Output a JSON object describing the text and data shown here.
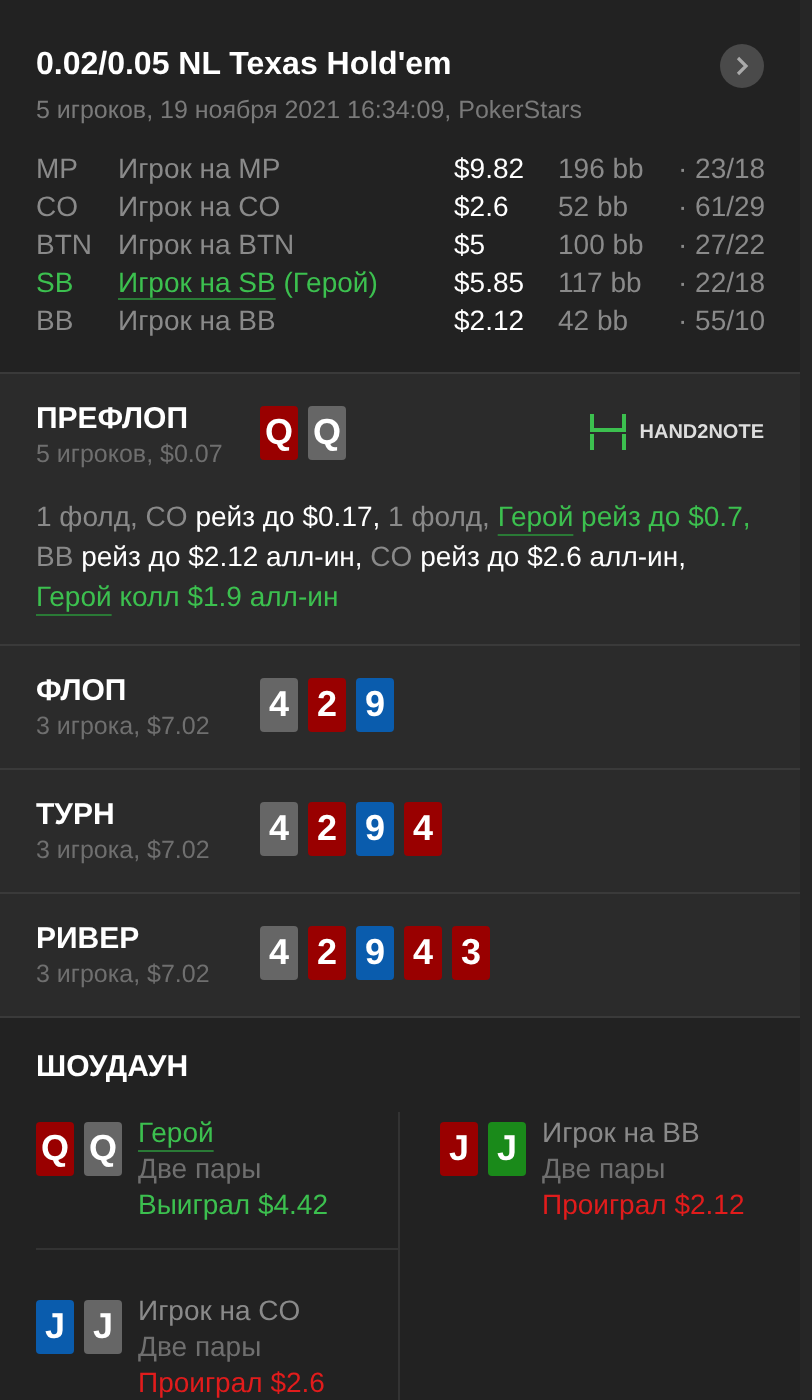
{
  "header": {
    "title": "0.02/0.05 NL Texas Hold'em",
    "subtitle": "5 игроков, 19 ноября 2021 16:34:09, PokerStars",
    "next_button": true
  },
  "players": [
    {
      "position": "MP",
      "name": "Игрок на MP",
      "hero": false,
      "stack": "$9.82",
      "bb": "196 bb",
      "stats": "· 23/18"
    },
    {
      "position": "CO",
      "name": "Игрок на CO",
      "hero": false,
      "stack": "$2.6",
      "bb": "52 bb",
      "stats": "· 61/29"
    },
    {
      "position": "BTN",
      "name": "Игрок на BTN",
      "hero": false,
      "stack": "$5",
      "bb": "100 bb",
      "stats": "· 27/22"
    },
    {
      "position": "SB",
      "name": "Игрок на SB",
      "hero_tag": "(Герой)",
      "hero": true,
      "stack": "$5.85",
      "bb": "117 bb",
      "stats": "· 22/18"
    },
    {
      "position": "BB",
      "name": "Игрок на BB",
      "hero": false,
      "stack": "$2.12",
      "bb": "42 bb",
      "stats": "· 55/10"
    }
  ],
  "streets": [
    {
      "title": "ПРЕФЛОП",
      "info": "5 игроков, $0.07",
      "logo": "HAND2NOTE",
      "cards": [
        {
          "rank": "Q",
          "color": "#990000"
        },
        {
          "rank": "Q",
          "color": "#666666"
        }
      ],
      "actions": [
        {
          "kind": "muted",
          "text": "1 фолд, CO "
        },
        {
          "kind": "action",
          "text": "рейз до $0.17, "
        },
        {
          "kind": "muted",
          "text": "1 фолд, "
        },
        {
          "kind": "hero-link",
          "text": "Герой"
        },
        {
          "kind": "hero",
          "text": " рейз до $0.7, "
        },
        {
          "kind": "muted",
          "text": "BB "
        },
        {
          "kind": "action",
          "text": "рейз до $2.12 алл-ин, "
        },
        {
          "kind": "muted",
          "text": "CO "
        },
        {
          "kind": "action",
          "text": "рейз до $2.6 алл-ин, "
        },
        {
          "kind": "hero-link",
          "text": "Герой"
        },
        {
          "kind": "hero",
          "text": " колл $1.9 алл-ин"
        }
      ]
    },
    {
      "title": "ФЛОП",
      "info": "3 игрока, $7.02",
      "cards": [
        {
          "rank": "4",
          "color": "#666666"
        },
        {
          "rank": "2",
          "color": "#990000"
        },
        {
          "rank": "9",
          "color": "#0a5cad"
        }
      ]
    },
    {
      "title": "ТУРН",
      "info": "3 игрока, $7.02",
      "cards": [
        {
          "rank": "4",
          "color": "#666666"
        },
        {
          "rank": "2",
          "color": "#990000"
        },
        {
          "rank": "9",
          "color": "#0a5cad"
        },
        {
          "rank": "4",
          "color": "#990000"
        }
      ]
    },
    {
      "title": "РИВЕР",
      "info": "3 игрока, $7.02",
      "cards": [
        {
          "rank": "4",
          "color": "#666666"
        },
        {
          "rank": "2",
          "color": "#990000"
        },
        {
          "rank": "9",
          "color": "#0a5cad"
        },
        {
          "rank": "4",
          "color": "#990000"
        },
        {
          "rank": "3",
          "color": "#990000"
        }
      ]
    }
  ],
  "showdown": {
    "title": "ШОУДАУН",
    "hands": [
      {
        "name": "Герой",
        "hero": true,
        "hand": "Две пары",
        "result": {
          "text": "Выиграл $4.42",
          "color": "#3cc04f"
        },
        "cards": [
          {
            "rank": "Q",
            "color": "#990000"
          },
          {
            "rank": "Q",
            "color": "#666666"
          }
        ]
      },
      {
        "name": "Игрок на BB",
        "hero": false,
        "hand": "Две пары",
        "result": {
          "text": "Проиграл $2.12",
          "color": "#e11c1c"
        },
        "cards": [
          {
            "rank": "J",
            "color": "#990000"
          },
          {
            "rank": "J",
            "color": "#1a8a1a"
          }
        ]
      },
      {
        "name": "Игрок на CO",
        "hero": false,
        "hand": "Две пары",
        "result": {
          "text": "Проиграл $2.6",
          "color": "#e11c1c"
        },
        "cards": [
          {
            "rank": "J",
            "color": "#0a5cad"
          },
          {
            "rank": "J",
            "color": "#666666"
          }
        ]
      }
    ]
  }
}
